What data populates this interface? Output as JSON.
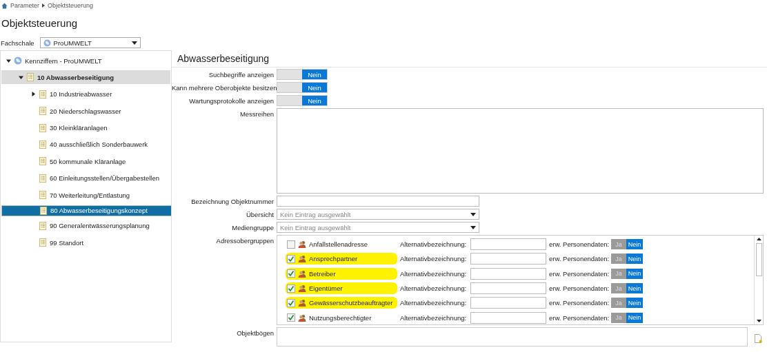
{
  "breadcrumb": [
    "Parameter",
    "Objektsteuerung"
  ],
  "title": "Objektsteuerung",
  "fachschale": {
    "label": "Fachschale",
    "value": "ProUMWELT"
  },
  "tree": [
    {
      "label": "Kennziffern - ProUMWELT",
      "selected": false,
      "highlighted": false,
      "expanded": true,
      "children": [
        {
          "label": "10 Abwasserbeseitigung",
          "selected": false,
          "highlighted": true,
          "expanded": true,
          "children": [
            {
              "label": "10 Industrieabwasser",
              "selected": false,
              "highlighted": false,
              "expanded": false
            },
            {
              "label": "20 Niederschlagswasser",
              "selected": false,
              "highlighted": false
            },
            {
              "label": "30 Kleinkläranlagen",
              "selected": false,
              "highlighted": false
            },
            {
              "label": "40 ausschließlich Sonderbauwerk",
              "selected": false,
              "highlighted": false
            },
            {
              "label": "50 kommunale Kläranlage",
              "selected": false,
              "highlighted": false
            },
            {
              "label": "60 Einleitungsstellen/Übergabestellen",
              "selected": false,
              "highlighted": false
            },
            {
              "label": "70 Weiterleitung/Entlastung",
              "selected": false,
              "highlighted": false
            },
            {
              "label": "80 Abwasserbeseitigungskonzept",
              "selected": true,
              "highlighted": false
            },
            {
              "label": "90 Generalentwässerungsplanung",
              "selected": false,
              "highlighted": false
            },
            {
              "label": "99 Standort",
              "selected": false,
              "highlighted": false
            }
          ]
        }
      ]
    }
  ],
  "detail": {
    "title": "Abwasserbeseitigung",
    "toggles": [
      {
        "label": "Suchbegriffe anzeigen",
        "on": false,
        "off_text": "Nein"
      },
      {
        "label": "Kann mehrere Oberobjekte besitzen",
        "on": false,
        "off_text": "Nein"
      },
      {
        "label": "Wartungsprotokolle anzeigen",
        "on": false,
        "off_text": "Nein"
      }
    ],
    "messreihen": {
      "label": "Messreihen"
    },
    "objektnummer": {
      "label": "Bezeichnung Objektnummer"
    },
    "selects": [
      {
        "label": "Übersicht",
        "placeholder": "Kein Eintrag ausgewählt"
      },
      {
        "label": "Mediengruppe",
        "placeholder": "Kein Eintrag ausgewählt"
      }
    ],
    "adressobergruppen": {
      "label": "Adressobergruppen",
      "rows": [
        {
          "name": "Anfallstellenadresse",
          "checked": false,
          "highlighted": false,
          "alt_label": "Alternativbezeichnung:",
          "ext_label": "erw. Personendaten:",
          "yes": "Ja",
          "no": "Nein",
          "ext_on": false
        },
        {
          "name": "Ansprechpartner",
          "checked": true,
          "highlighted": true,
          "alt_label": "Alternativbezeichnung:",
          "ext_label": "erw. Personendaten:",
          "yes": "Ja",
          "no": "Nein",
          "ext_on": false
        },
        {
          "name": "Betreiber",
          "checked": true,
          "highlighted": true,
          "alt_label": "Alternativbezeichnung:",
          "ext_label": "erw. Personendaten:",
          "yes": "Ja",
          "no": "Nein",
          "ext_on": false
        },
        {
          "name": "Eigentümer",
          "checked": true,
          "highlighted": true,
          "alt_label": "Alternativbezeichnung:",
          "ext_label": "erw. Personendaten:",
          "yes": "Ja",
          "no": "Nein",
          "ext_on": false
        },
        {
          "name": "Gewässerschutzbeauftragter",
          "checked": true,
          "highlighted": true,
          "alt_label": "Alternativbezeichnung:",
          "ext_label": "erw. Personendaten:",
          "yes": "Ja",
          "no": "Nein",
          "ext_on": false
        },
        {
          "name": "Nutzungsberechtigter",
          "checked": true,
          "highlighted": false,
          "alt_label": "Alternativbezeichnung:",
          "ext_label": "erw. Personendaten:",
          "yes": "Ja",
          "no": "Nein",
          "ext_on": false
        }
      ]
    },
    "objektboegen": {
      "label": "Objektbögen"
    }
  }
}
